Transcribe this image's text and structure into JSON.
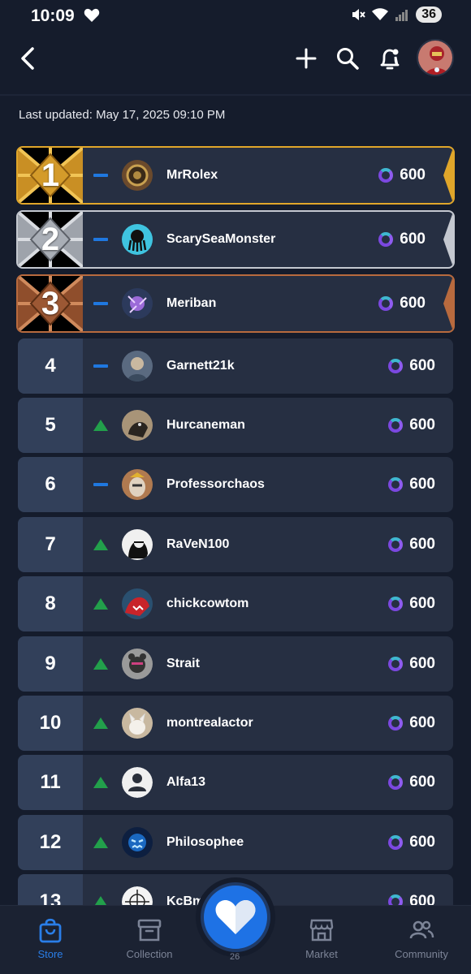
{
  "status": {
    "time": "10:09",
    "battery": "36"
  },
  "header": {
    "back_icon": "chevron-left-icon",
    "add_icon": "plus-icon",
    "search_icon": "search-icon",
    "notif_icon": "bell-icon"
  },
  "last_updated": "Last updated: May 17, 2025 09:10 PM",
  "leaderboard": [
    {
      "rank": "1",
      "name": "MrRolex",
      "score": "600",
      "trend": "same"
    },
    {
      "rank": "2",
      "name": "ScarySeaMonster",
      "score": "600",
      "trend": "same"
    },
    {
      "rank": "3",
      "name": "Meriban",
      "score": "600",
      "trend": "same"
    },
    {
      "rank": "4",
      "name": "Garnett21k",
      "score": "600",
      "trend": "same"
    },
    {
      "rank": "5",
      "name": "Hurcaneman",
      "score": "600",
      "trend": "up"
    },
    {
      "rank": "6",
      "name": "Professorchaos",
      "score": "600",
      "trend": "same"
    },
    {
      "rank": "7",
      "name": "RaVeN100",
      "score": "600",
      "trend": "up"
    },
    {
      "rank": "8",
      "name": "chickcowtom",
      "score": "600",
      "trend": "up"
    },
    {
      "rank": "9",
      "name": "Strait",
      "score": "600",
      "trend": "up"
    },
    {
      "rank": "10",
      "name": "montrealactor",
      "score": "600",
      "trend": "up"
    },
    {
      "rank": "11",
      "name": "Alfa13",
      "score": "600",
      "trend": "up"
    },
    {
      "rank": "12",
      "name": "Philosophee",
      "score": "600",
      "trend": "up"
    },
    {
      "rank": "13",
      "name": "KcBmw",
      "score": "600",
      "trend": "up"
    }
  ],
  "nav": {
    "store": "Store",
    "collection": "Collection",
    "market": "Market",
    "community": "Community",
    "fab_badge": "26"
  },
  "colors": {
    "gold": "#e0a62a",
    "silver": "#c4c8d0",
    "bronze": "#b86a3e",
    "accent": "#1e72e5",
    "trend_up": "#22a04b",
    "trend_same": "#1f78e0"
  }
}
